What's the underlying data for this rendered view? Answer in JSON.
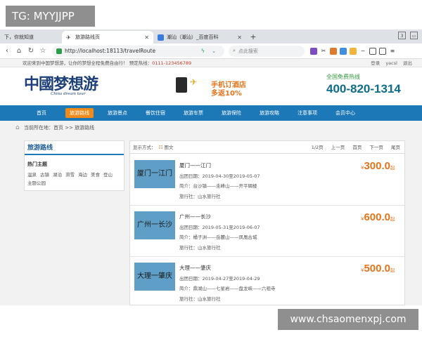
{
  "overlay_tag": "TG: MYYJJPP",
  "watermark": "www.chsaomenxpj.com",
  "browser": {
    "tabs": [
      {
        "label": "下，你就知道"
      },
      {
        "label": "旅游路线页"
      },
      {
        "label": "潮汕（潮汕）_百度百科"
      }
    ],
    "new_tab": "+",
    "url": "http://localhost:18113/travelRoute",
    "search_placeholder": "点此搜索"
  },
  "topstrip": {
    "welcome": "欢迎来到中国梦想游，让你的梦想全程免费自由行！ 预定热线：",
    "hotline": "0111-123456789",
    "links": [
      "登录",
      "yacsl",
      "退出"
    ]
  },
  "header": {
    "logo": "中國梦想游",
    "logo_sub": "China dream tour",
    "promo_line1": "手机订酒店",
    "promo_line2": "多返10%",
    "hotline_label": "全国免费热线",
    "hotline_number": "400-820-1314"
  },
  "nav": [
    "首页",
    "旅游路线",
    "旅游景点",
    "餐饮住宿",
    "旅游车票",
    "旅游保险",
    "旅游攻略",
    "注意事项",
    "会员中心"
  ],
  "breadcrumb": "当前所在地：首页 >> 旅游路线",
  "sidebar": {
    "title": "旅游路线",
    "hot_title": "热门主题",
    "tags": [
      "温泉",
      "古镇",
      "湖泊",
      "滑雪",
      "海边",
      "美食",
      "登山",
      "主题公园"
    ]
  },
  "listing": {
    "display_label": "显示方式：",
    "display_mode": "图文",
    "pager": [
      "1/2页",
      "上一页",
      "首页",
      "下一页",
      "尾页"
    ],
    "routes": [
      {
        "thumb": "厦门一江门",
        "name": "厦门——江门",
        "date": "出团日期：2019-04-30至2019-05-07",
        "intro": "简介：台沙镇——圭峰山——开平碉楼",
        "agency": "旅行社：山水旅行社",
        "currency": "¥",
        "price": "300.0",
        "suffix": "起"
      },
      {
        "thumb": "广州一长沙",
        "name": "广州——长沙",
        "date": "出团日期：2019-05-31至2019-06-07",
        "intro": "简介：橘子洲——岳麓山——凤凰古城",
        "agency": "旅行社：山水旅行社",
        "currency": "¥",
        "price": "600.0",
        "suffix": "起"
      },
      {
        "thumb": "大理一肇庆",
        "name": "大理——肇庆",
        "date": "出团日期：2019-04-27至2019-04-29",
        "intro": "简介：鼎湖山——七星岩——盘龙峡——六祖寺",
        "agency": "旅行社：山水旅行社",
        "currency": "¥",
        "price": "500.0",
        "suffix": "起"
      }
    ]
  }
}
